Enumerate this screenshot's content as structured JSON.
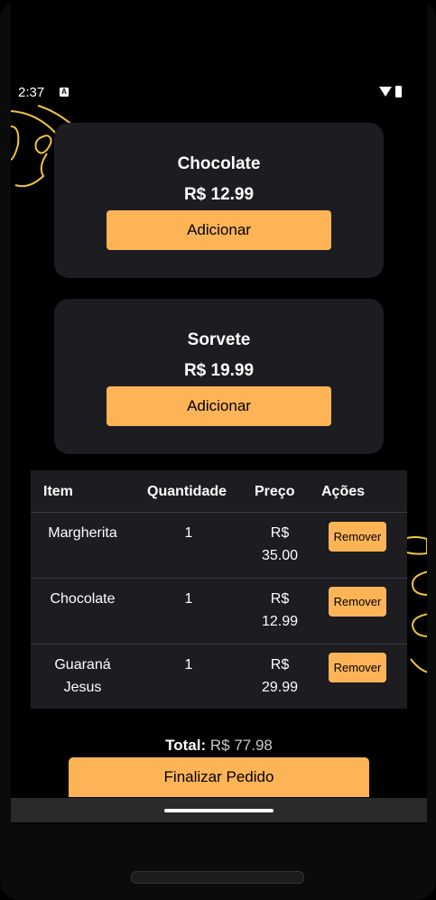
{
  "status_bar": {
    "time": "2:37",
    "notification_icon": "A"
  },
  "products": [
    {
      "name": "Chocolate",
      "price": "R$ 12.99",
      "button_label": "Adicionar"
    },
    {
      "name": "Sorvete",
      "price": "R$ 19.99",
      "button_label": "Adicionar"
    }
  ],
  "cart": {
    "headers": {
      "item": "Item",
      "quantity": "Quantidade",
      "price": "Preço",
      "actions": "Ações"
    },
    "rows": [
      {
        "item": [
          "Margherita"
        ],
        "quantity": "1",
        "price": [
          "R$",
          "35.00"
        ],
        "action": "Remover"
      },
      {
        "item": [
          "Chocolate"
        ],
        "quantity": "1",
        "price": [
          "R$",
          "12.99"
        ],
        "action": "Remover"
      },
      {
        "item": [
          "Guaraná",
          "Jesus"
        ],
        "quantity": "1",
        "price": [
          "R$",
          "29.99"
        ],
        "action": "Remover"
      }
    ]
  },
  "summary": {
    "total_label": "Total:",
    "total_value": "R$ 77.98"
  },
  "finalize_label": "Finalizar Pedido",
  "colors": {
    "accent": "#fdb456",
    "card": "#1c1c21",
    "background": "#000000",
    "decoration": "#f2c541"
  },
  "icons": [
    "wifi-icon",
    "battery-icon",
    "notification-a-icon"
  ]
}
